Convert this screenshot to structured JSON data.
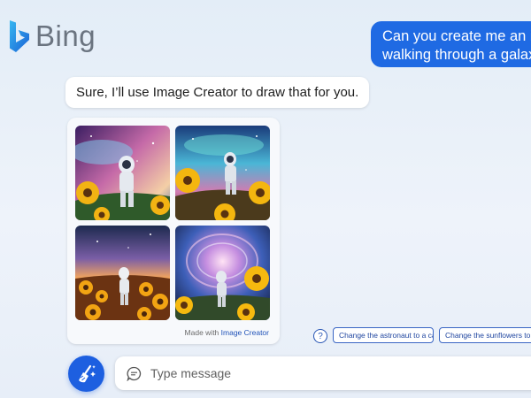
{
  "brand": {
    "name": "Bing"
  },
  "conversation": {
    "user_message_lines": [
      "Can you create me an ima",
      "walking through a galaxy"
    ],
    "bot_message": "Sure, I’ll use Image Creator to draw that for you."
  },
  "gallery": {
    "caption_prefix": "Made with ",
    "caption_link": "Image Creator",
    "images": [
      "astronaut-in-galaxy-1",
      "astronaut-in-galaxy-2",
      "astronaut-in-galaxy-3",
      "astronaut-in-galaxy-4"
    ]
  },
  "suggestions": {
    "help_icon": "?",
    "chips": [
      "Change the astronaut to a cat",
      "Change the sunflowers to ro"
    ]
  },
  "composer": {
    "placeholder": "Type message"
  },
  "icons": {
    "new-topic": "broom-sparkle-icon",
    "chat": "chat-bubble-icon"
  },
  "colors": {
    "accent": "#1f6ae3",
    "link": "#2052b8"
  }
}
